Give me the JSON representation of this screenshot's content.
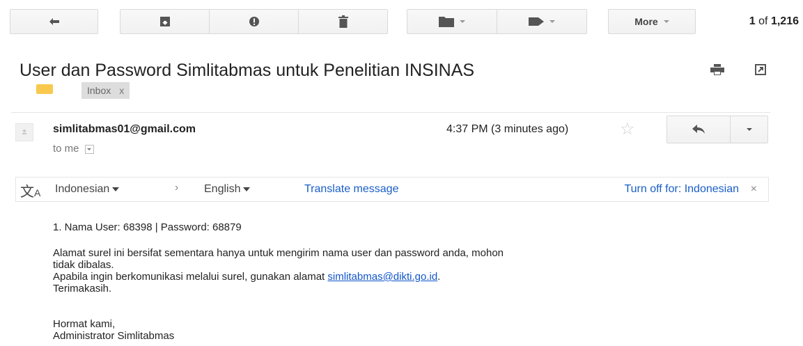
{
  "toolbar": {
    "back_icon": "back-arrow-icon",
    "archive_icon": "archive-icon",
    "spam_icon": "report-spam-icon",
    "delete_icon": "trash-icon",
    "move_icon": "folder-icon",
    "labels_icon": "label-tag-icon",
    "more_label": "More",
    "count_current": "1",
    "count_of": "of",
    "count_total": "1,216"
  },
  "header": {
    "subject": "User dan Password Simlitabmas untuk Penelitian INSINAS",
    "inbox_chip": "Inbox",
    "inbox_chip_close": "x",
    "print_icon": "print-icon",
    "newwindow_icon": "new-window-icon"
  },
  "message": {
    "sender": "simlitabmas01@gmail.com",
    "to_line": "to me",
    "time": "4:37 PM (3 minutes ago)",
    "star": "☆"
  },
  "translate": {
    "from_lang": "Indonesian",
    "arrow": "›",
    "to_lang": "English",
    "translate_link": "Translate message",
    "turn_off": "Turn off for: Indonesian",
    "close": "×"
  },
  "body": {
    "line1": "1. Nama User:  68398 | Password: 68879",
    "para1_a": "Alamat surel ini bersifat sementara hanya untuk mengirim nama user dan password anda, mohon",
    "para1_b": "tidak dibalas.",
    "para2_prefix": "Apabila ingin berkomunikasi melalui surel, gunakan alamat ",
    "para2_link": "simlitabmas@dikti.go.id",
    "para2_suffix": ".",
    "para3": "Terimakasih.",
    "sign1": "Hormat kami,",
    "sign2": "Administrator Simlitabmas"
  }
}
